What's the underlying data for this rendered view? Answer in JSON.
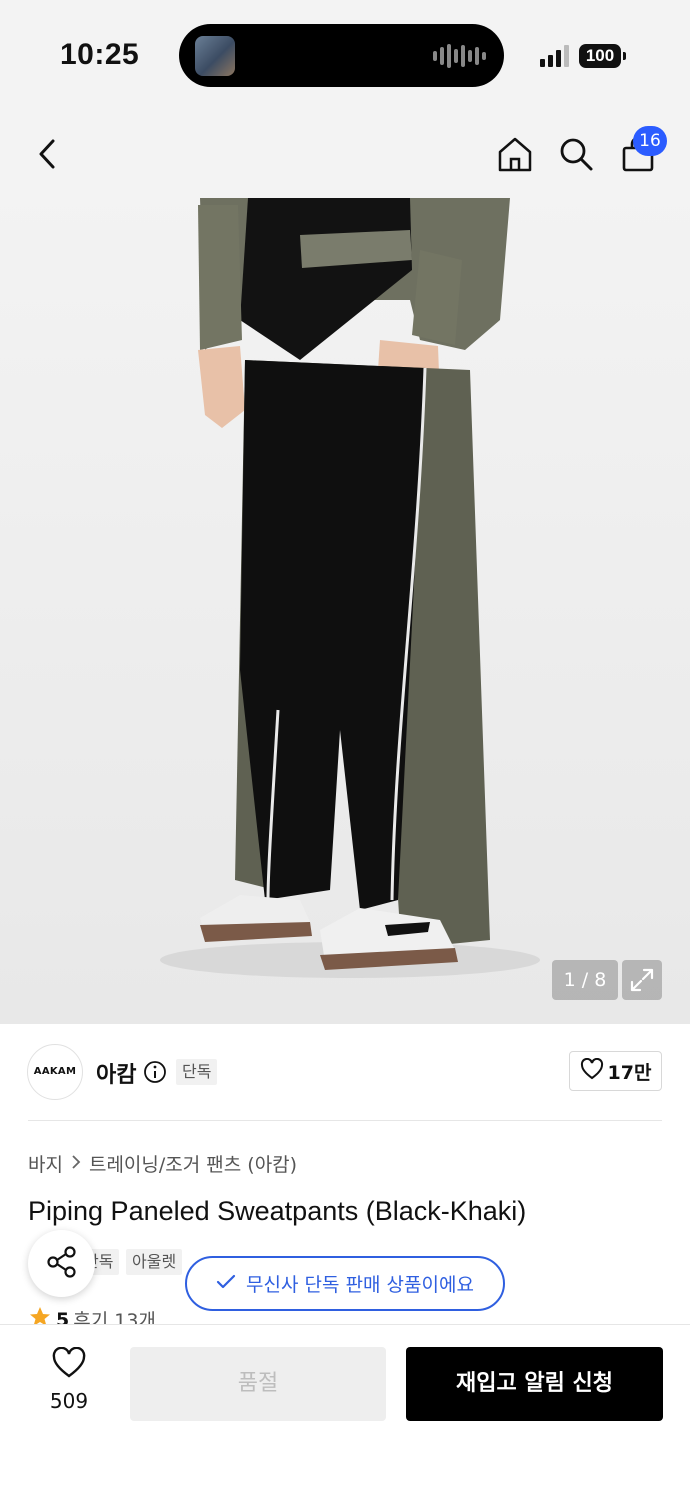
{
  "status_bar": {
    "time": "10:25",
    "battery": "100"
  },
  "nav": {
    "cart_count": "16"
  },
  "gallery": {
    "counter": "1 / 8"
  },
  "brand": {
    "logo_text": "AAKAM",
    "name": "아캄",
    "tags": [
      "단독"
    ],
    "likes": "17만"
  },
  "breadcrumb": {
    "category": "바지",
    "subcategory": "트레이닝/조거 팬츠 (아캄)"
  },
  "product": {
    "title": "Piping Paneled Sweatpants (Black-Khaki)",
    "tags": [
      "단독",
      "아울렛"
    ],
    "rating": "5",
    "reviews": "후기 13개"
  },
  "toast": {
    "text": "무신사 단독 판매 상품이에요"
  },
  "bottom": {
    "wish_count": "509",
    "soldout_label": "품절",
    "restock_label": "재입고 알림 신청"
  },
  "colors": {
    "accent": "#2f5fe0",
    "badge": "#2b5cff",
    "star": "#f5a623"
  },
  "icons": [
    "back-icon",
    "home-icon",
    "search-icon",
    "shopping-bag-icon",
    "expand-icon",
    "info-icon",
    "heart-icon",
    "share-icon",
    "check-icon",
    "star-icon"
  ]
}
